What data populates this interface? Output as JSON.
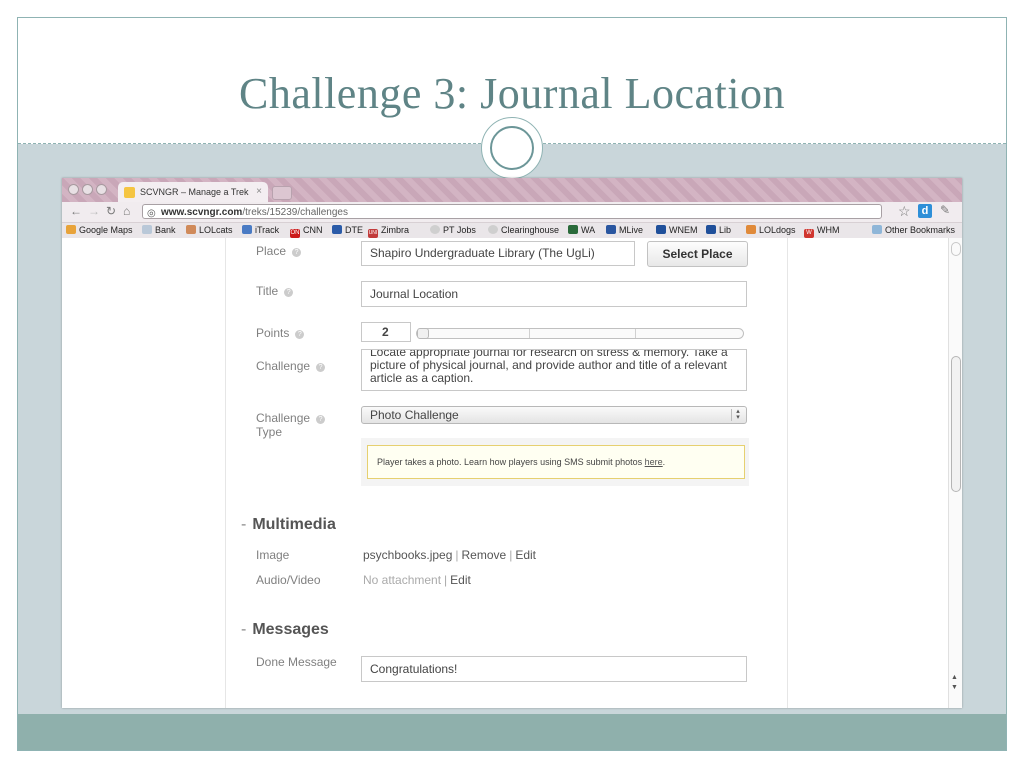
{
  "slide": {
    "title": "Challenge 3: Journal Location"
  },
  "browser": {
    "tab_title": "SCVNGR – Manage a Trek",
    "url_host": "www.scvngr.com",
    "url_path": "/treks/15239/challenges",
    "bookmarks": [
      "Google Maps",
      "Bank",
      "LOLcats",
      "iTrack",
      "CNN",
      "DTE",
      "Zimbra",
      "PT Jobs",
      "Clearinghouse",
      "WA",
      "MLive",
      "WNEM",
      "Lib",
      "LOLdogs",
      "WHM"
    ],
    "other_bookmarks": "Other Bookmarks",
    "bookmark_icons": {
      "CNN": "ON",
      "Zimbra": "UNI",
      "WHM": "W"
    }
  },
  "form": {
    "place_label": "Place",
    "place_value": "Shapiro Undergraduate Library (The UgLi)",
    "select_place_button": "Select Place",
    "title_label": "Title",
    "title_value": "Journal Location",
    "points_label": "Points",
    "points_value": "2",
    "points_level": 0,
    "challenge_label": "Challenge",
    "challenge_text": "Locate appropriate journal for research on stress & memory. Take a picture of physical journal, and provide author and title of a relevant article as a caption.",
    "challenge_type_label_1": "Challenge",
    "challenge_type_label_2": "Type",
    "challenge_type_value": "Photo Challenge",
    "info_text": "Player takes a photo. Learn how players using SMS submit photos ",
    "info_link": "here",
    "info_end": "."
  },
  "multimedia": {
    "dash": "-",
    "title": "Multimedia",
    "image_label": "Image",
    "image_file": "psychbooks.jpeg",
    "image_sep": "|",
    "remove_link": "Remove",
    "edit_link": "Edit",
    "audio_label": "Audio/Video",
    "audio_value": "No attachment",
    "audio_edit": "Edit"
  },
  "messages": {
    "dash": "-",
    "title": "Messages",
    "done_label": "Done Message",
    "done_value": "Congratulations!"
  },
  "colors": {
    "slide_title": "#5f8486",
    "frame": "#c9d6da",
    "footer": "#8fb0ac",
    "tab_bar": "#c9a7b8"
  }
}
